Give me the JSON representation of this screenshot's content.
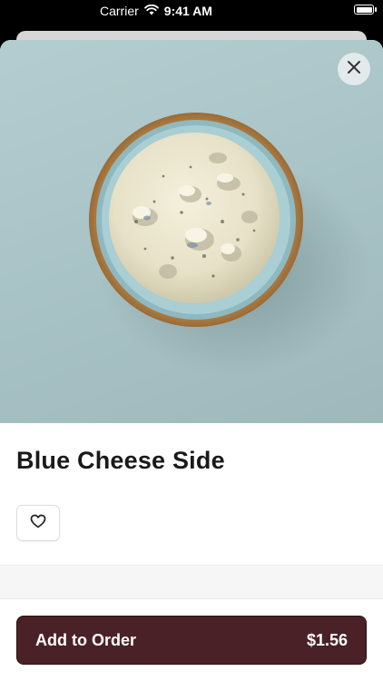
{
  "status_bar": {
    "carrier": "Carrier",
    "time": "9:41 AM"
  },
  "item": {
    "title": "Blue Cheese Side",
    "image_alt": "bowl of blue cheese dressing"
  },
  "actions": {
    "add_label": "Add to Order",
    "price": "$1.56"
  },
  "icons": {
    "close": "close-icon",
    "favorite": "heart-icon",
    "wifi": "wifi-icon",
    "battery": "battery-icon"
  },
  "colors": {
    "accent": "#4a2127",
    "hero_background": "#a9c3c6",
    "bowl_rim": "#c08a4c",
    "dressing": "#e9e4cc"
  }
}
